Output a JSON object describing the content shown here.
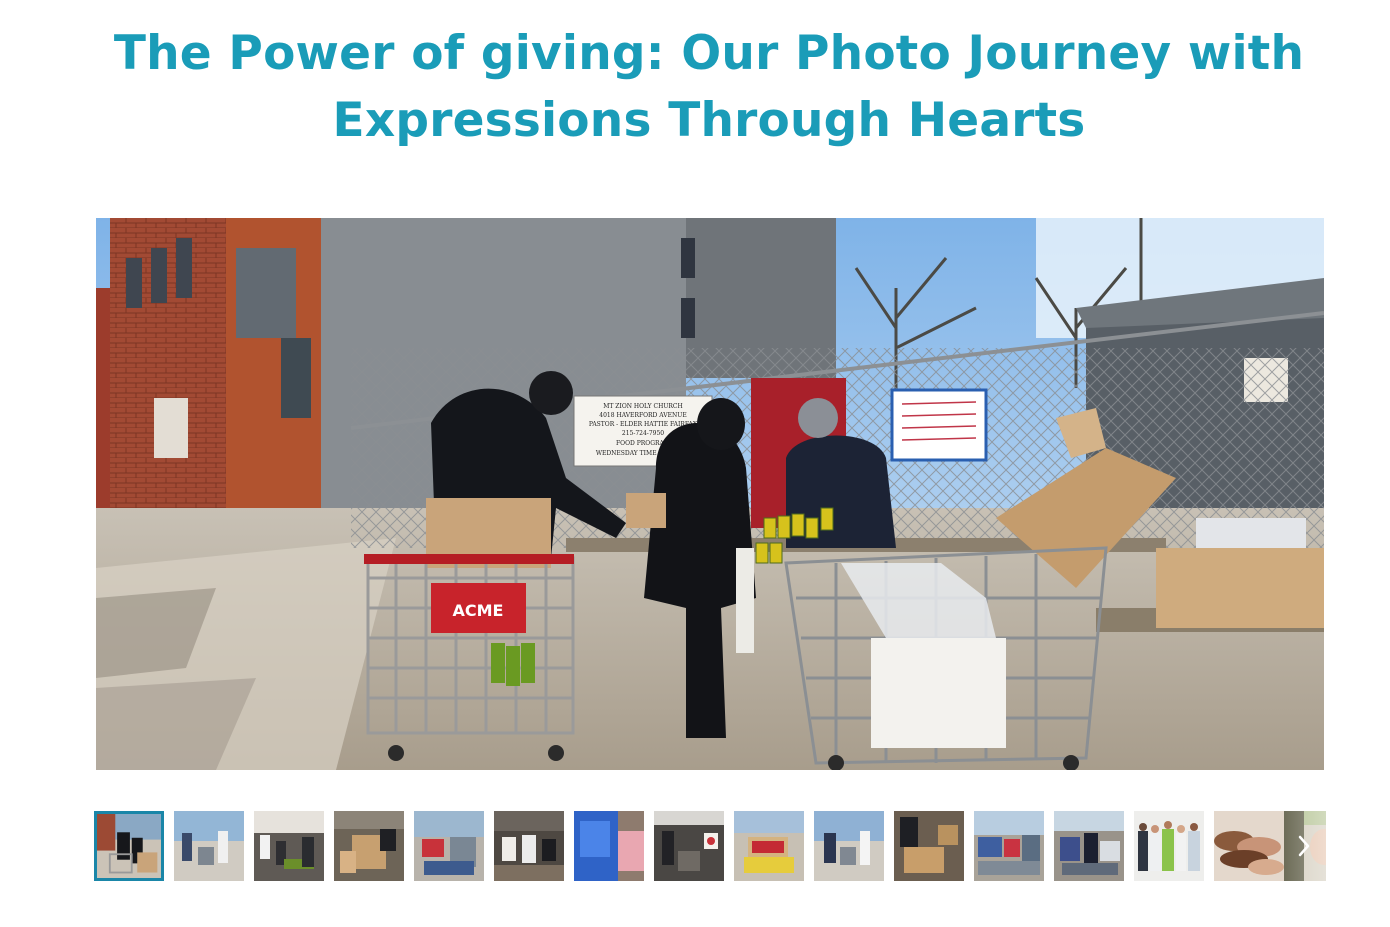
{
  "title": {
    "line1": "The Power of giving: Our Photo Journey with",
    "line2": "Expressions Through Hearts"
  },
  "gallery": {
    "current_index": 1,
    "total_thumbnails": 16,
    "photo_sign": {
      "church": "MT ZION HOLY CHURCH",
      "address": "4018 HAVERFORD AVENUE",
      "pastor": "PASTOR - ELDER HATTIE FAIRFAX",
      "phone": "215-724-7950",
      "program": "FOOD PROGRAM",
      "time": "WEDNESDAY TIME 10:00AM -"
    },
    "cart_sign": "ACME",
    "prev_icon": "chevron-left-icon",
    "next_icon": "chevron-right-icon"
  },
  "colors": {
    "title": "#1a9cb8",
    "active_thumb_border": "#1a86a8"
  }
}
